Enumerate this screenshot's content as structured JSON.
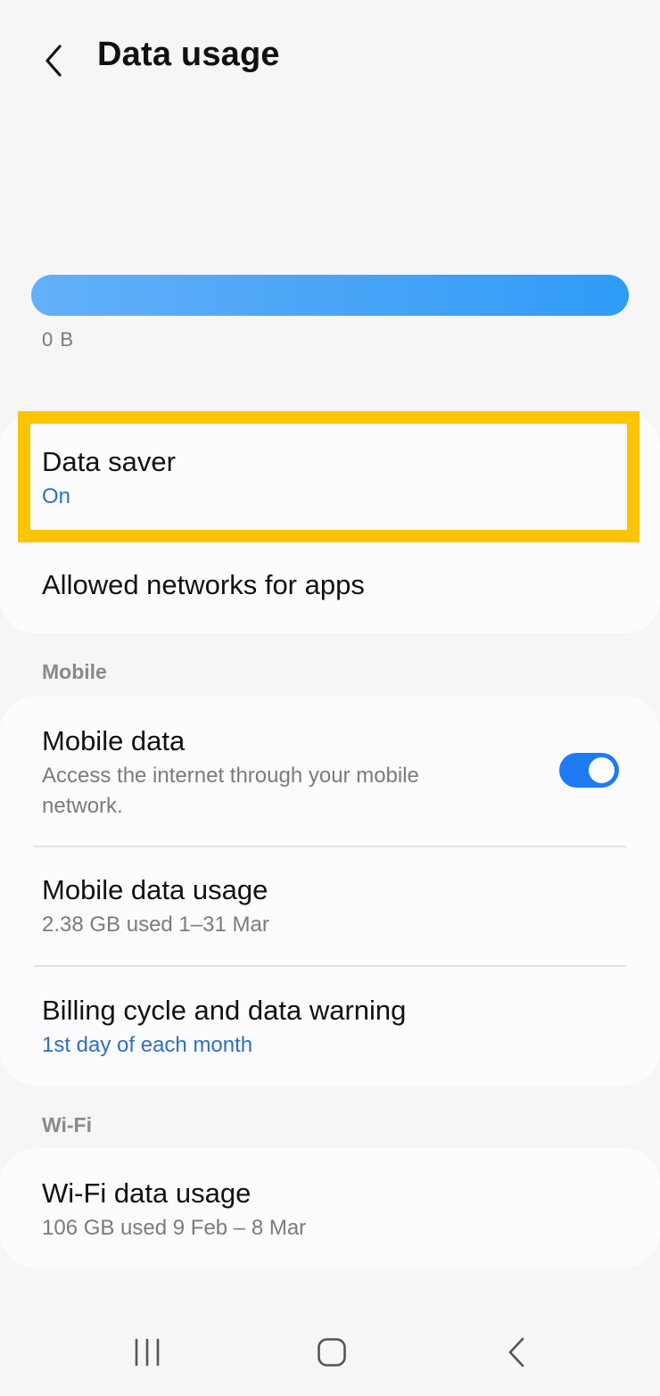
{
  "header": {
    "title": "Data usage",
    "back_icon": "chevron-left-icon"
  },
  "usage": {
    "amount_label": "0 B",
    "bar_color": "#4aa5f7"
  },
  "cards": {
    "data_saver": {
      "title": "Data saver",
      "status": "On"
    },
    "allowed_networks": {
      "title": "Allowed networks for apps"
    }
  },
  "mobile": {
    "section_label": "Mobile",
    "mobile_data": {
      "title": "Mobile data",
      "description": "Access the internet through your mobile network.",
      "enabled": true
    },
    "mobile_data_usage": {
      "title": "Mobile data usage",
      "detail": "2.38 GB used 1–31 Mar"
    },
    "billing_cycle": {
      "title": "Billing cycle and data warning",
      "detail": "1st day of each month"
    }
  },
  "wifi": {
    "section_label": "Wi-Fi",
    "wifi_data_usage": {
      "title": "Wi-Fi data usage",
      "detail": "106 GB used 9 Feb – 8 Mar"
    }
  },
  "colors": {
    "accent": "#1f7af3",
    "link_blue": "#2f6fbd",
    "highlight": "#fdc400",
    "background": "#f6f6f8"
  },
  "navbar": {
    "recents_icon": "recents-icon",
    "home_icon": "home-icon",
    "back_icon": "back-icon"
  }
}
